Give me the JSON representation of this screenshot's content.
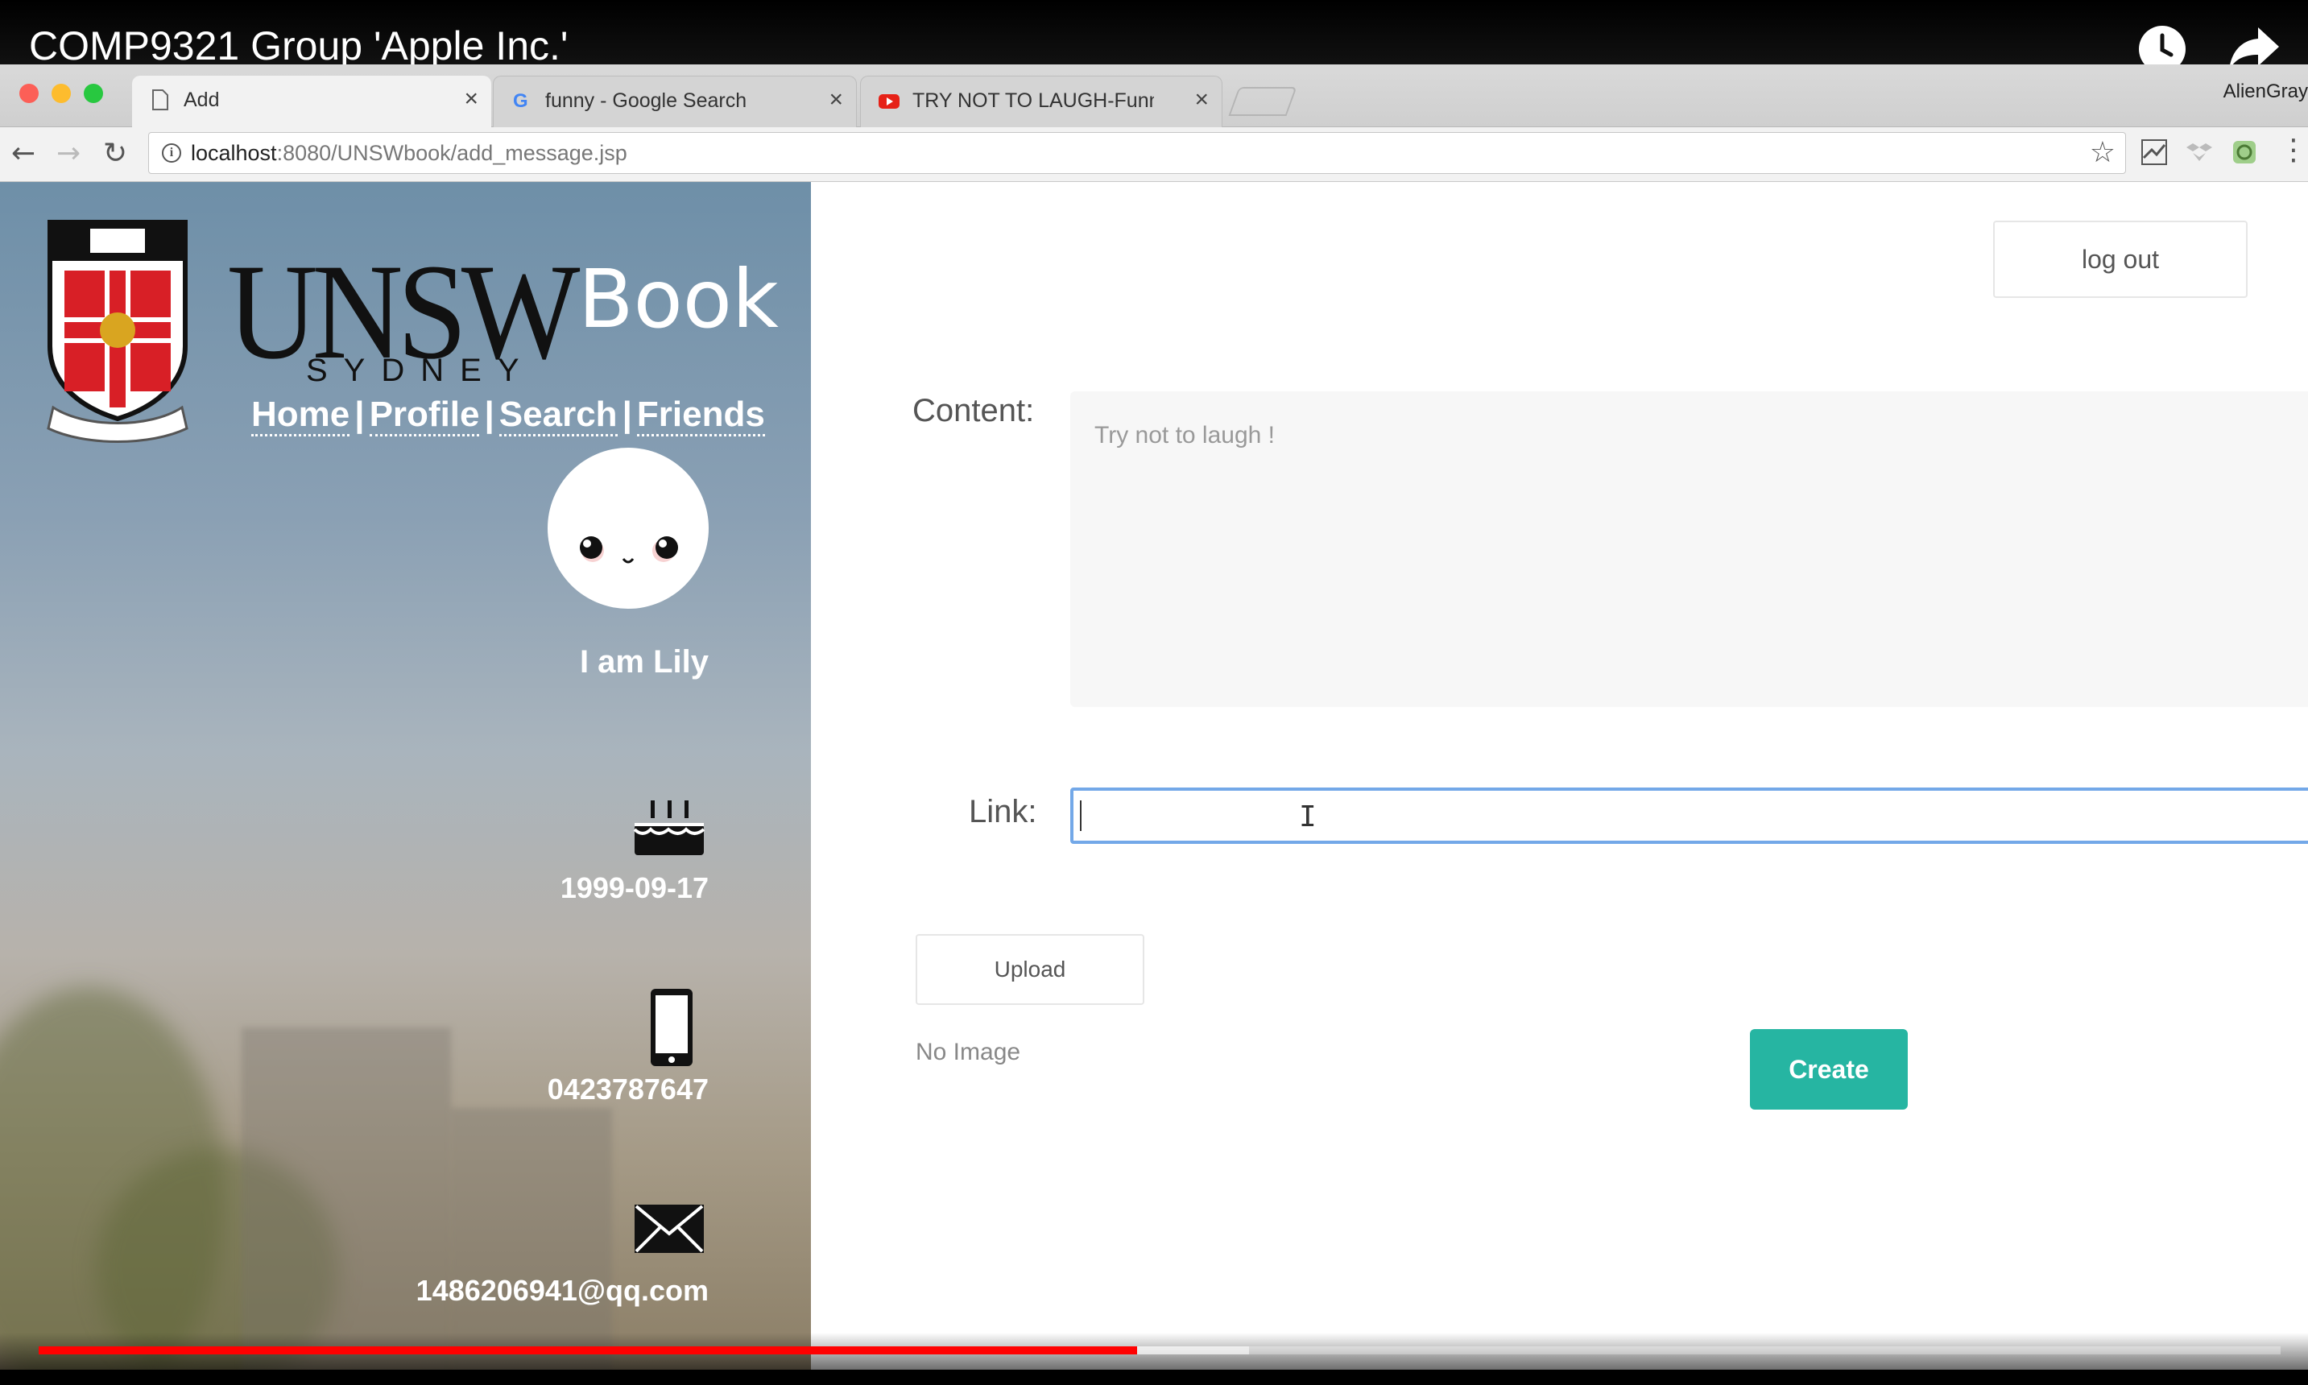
{
  "video": {
    "title": "COMP9321 Group 'Apple Inc.'",
    "icons": [
      "clock-icon",
      "share-icon"
    ],
    "progress": {
      "played_fraction": 0.49,
      "buffered_fraction": 0.54,
      "played_color": "#ff0000"
    }
  },
  "browser": {
    "tabs": [
      {
        "label": "Add",
        "icon": "page-icon",
        "active": true
      },
      {
        "label": "funny - Google Search",
        "icon": "google-icon",
        "active": false
      },
      {
        "label": "TRY NOT TO LAUGH-Funny Ki",
        "icon": "youtube-icon",
        "active": false
      }
    ],
    "profile_name": "AlienGray",
    "url_host": "localhost",
    "url_rest": ":8080/UNSWbook/add_message.jsp"
  },
  "sidebar": {
    "logo": {
      "unsw": "UNSW",
      "book": "Book",
      "sydney": "SYDNEY"
    },
    "nav": {
      "home": "Home",
      "profile": "Profile",
      "search": "Search",
      "friends": "Friends",
      "separator": "|"
    },
    "about": "I am Lily",
    "birthday": "1999-09-17",
    "phone": "0423787647",
    "email": "1486206941@qq.com",
    "background_tint": "#8aa0b4"
  },
  "main": {
    "logout_label": "log out",
    "content_label": "Content:",
    "content_placeholder": "Try not to laugh !",
    "link_label": "Link:",
    "link_value": "",
    "upload_label": "Upload",
    "image_status": "No Image",
    "create_label": "Create",
    "accent_color": "#26b5a2"
  }
}
